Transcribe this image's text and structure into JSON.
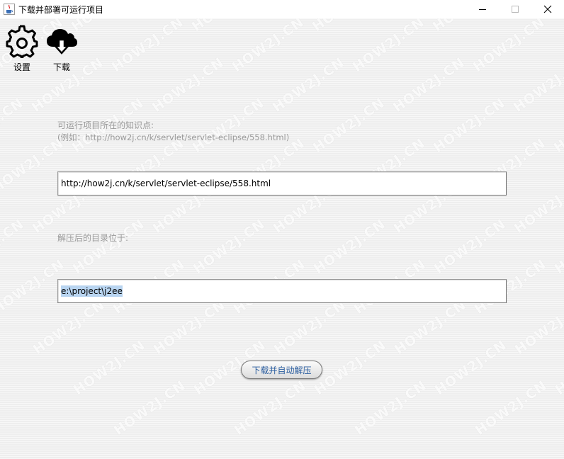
{
  "window": {
    "title": "下载并部署可运行项目",
    "icon": "java-cup-icon"
  },
  "toolbar": {
    "settings_label": "设置",
    "download_label": "下载"
  },
  "form": {
    "url_label": "可运行项目所在的知识点:",
    "url_hint": "(例如：http://how2j.cn/k/servlet/servlet-eclipse/558.html)",
    "url_value": "http://how2j.cn/k/servlet/servlet-eclipse/558.html",
    "dir_label": "解压后的目录位于:",
    "dir_value": "e:\\project\\j2ee"
  },
  "action": {
    "button_label": "下载并自动解压"
  },
  "watermark": {
    "text": "HOW2J.CN"
  },
  "colors": {
    "accent_text": "#2a5d9f",
    "selection": "#b8d4f0",
    "background": "#eeeeee"
  }
}
